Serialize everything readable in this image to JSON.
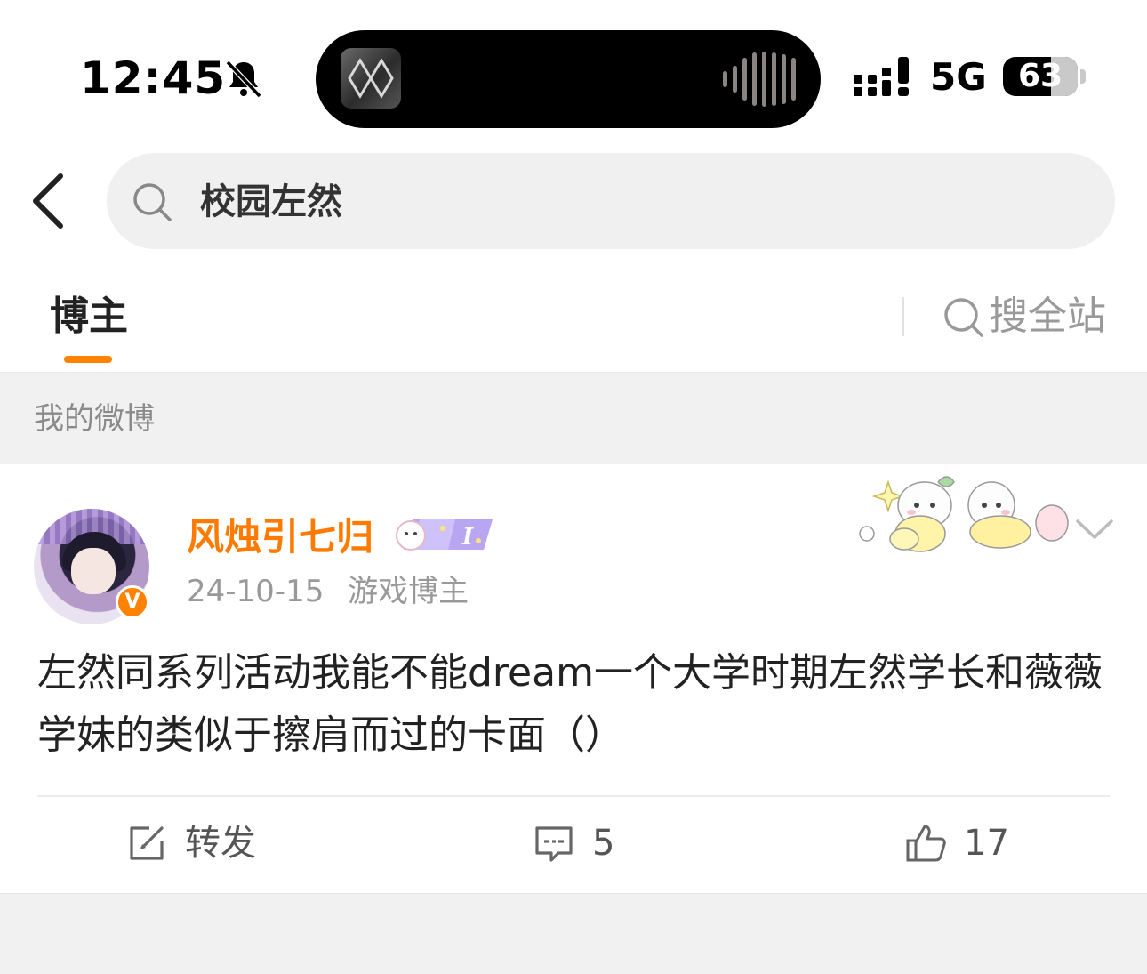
{
  "status_bar": {
    "time": "12:45",
    "network": "5G",
    "battery_level": "63",
    "icons": [
      "bell-muted-icon",
      "signal-icon",
      "battery-icon"
    ]
  },
  "header": {
    "back_icon": "chevron-left-icon",
    "search_icon": "search-icon",
    "query": "校园左然"
  },
  "tabs": {
    "active": "博主",
    "search_all_label": "搜全站",
    "accent_color": "#ff8200"
  },
  "section": {
    "title": "我的微博"
  },
  "post": {
    "username": "风烛引七归",
    "username_color": "#ff7a00",
    "verified_badge": "V",
    "date": "24-10-15",
    "category": "游戏博主",
    "text": "左然同系列活动我能不能dream一个大学时期左然学长和薇薇学妹的类似于擦肩而过的卡面（）",
    "actions": {
      "repost_label": "转发",
      "comment_count": "5",
      "like_count": "17"
    }
  }
}
